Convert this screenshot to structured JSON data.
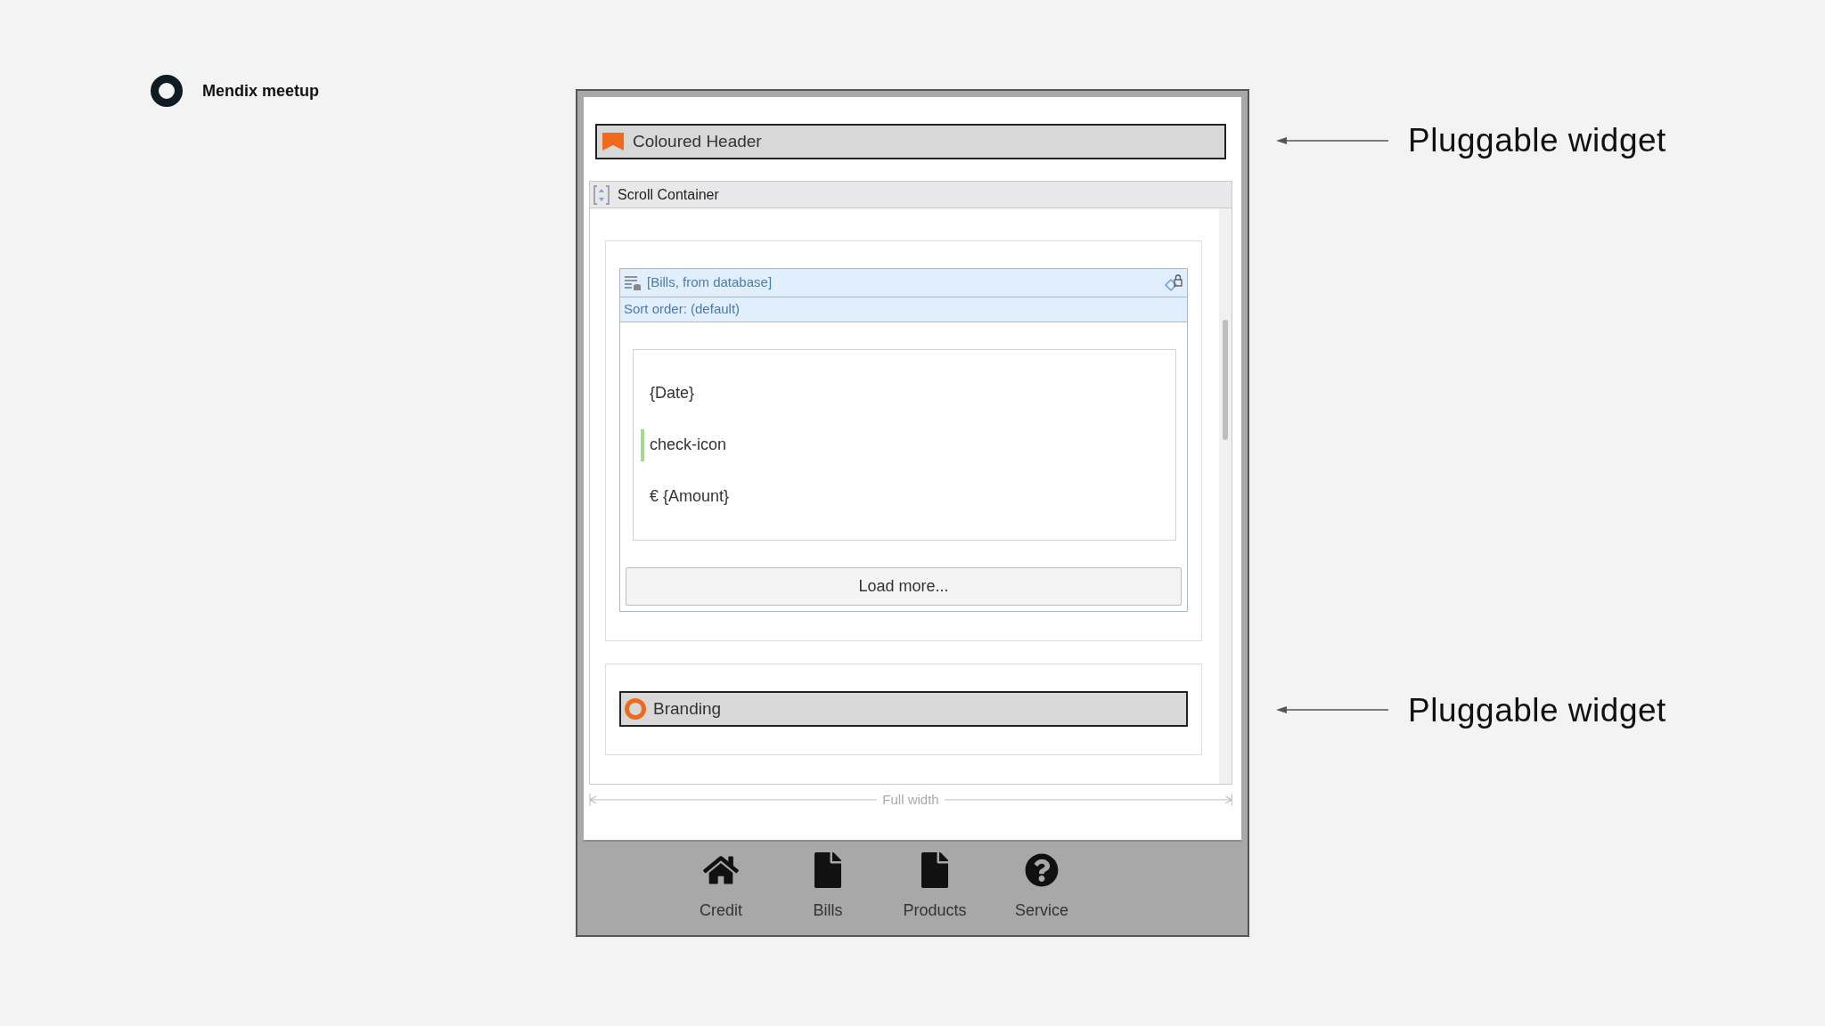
{
  "slide": {
    "brand": "Mendix meetup"
  },
  "page": {
    "coloured_header": "Coloured Header",
    "scroll_container": "Scroll Container",
    "data_view": {
      "source": "[Bills, from database]",
      "sort_order": "Sort order: (default)",
      "fields": [
        {
          "text": "{Date}",
          "kind": "text"
        },
        {
          "text": "check-icon",
          "kind": "icon"
        },
        {
          "text": "€ {Amount}",
          "kind": "text"
        }
      ],
      "load_more": "Load more..."
    },
    "branding": "Branding",
    "width_label": "Full width"
  },
  "bottom_nav": [
    {
      "label": "Credit",
      "kind": "home"
    },
    {
      "label": "Bills",
      "kind": "file"
    },
    {
      "label": "Products",
      "kind": "file"
    },
    {
      "label": "Service",
      "kind": "help"
    }
  ],
  "annotations": [
    {
      "text": "Pluggable widget"
    },
    {
      "text": "Pluggable widget"
    }
  ]
}
